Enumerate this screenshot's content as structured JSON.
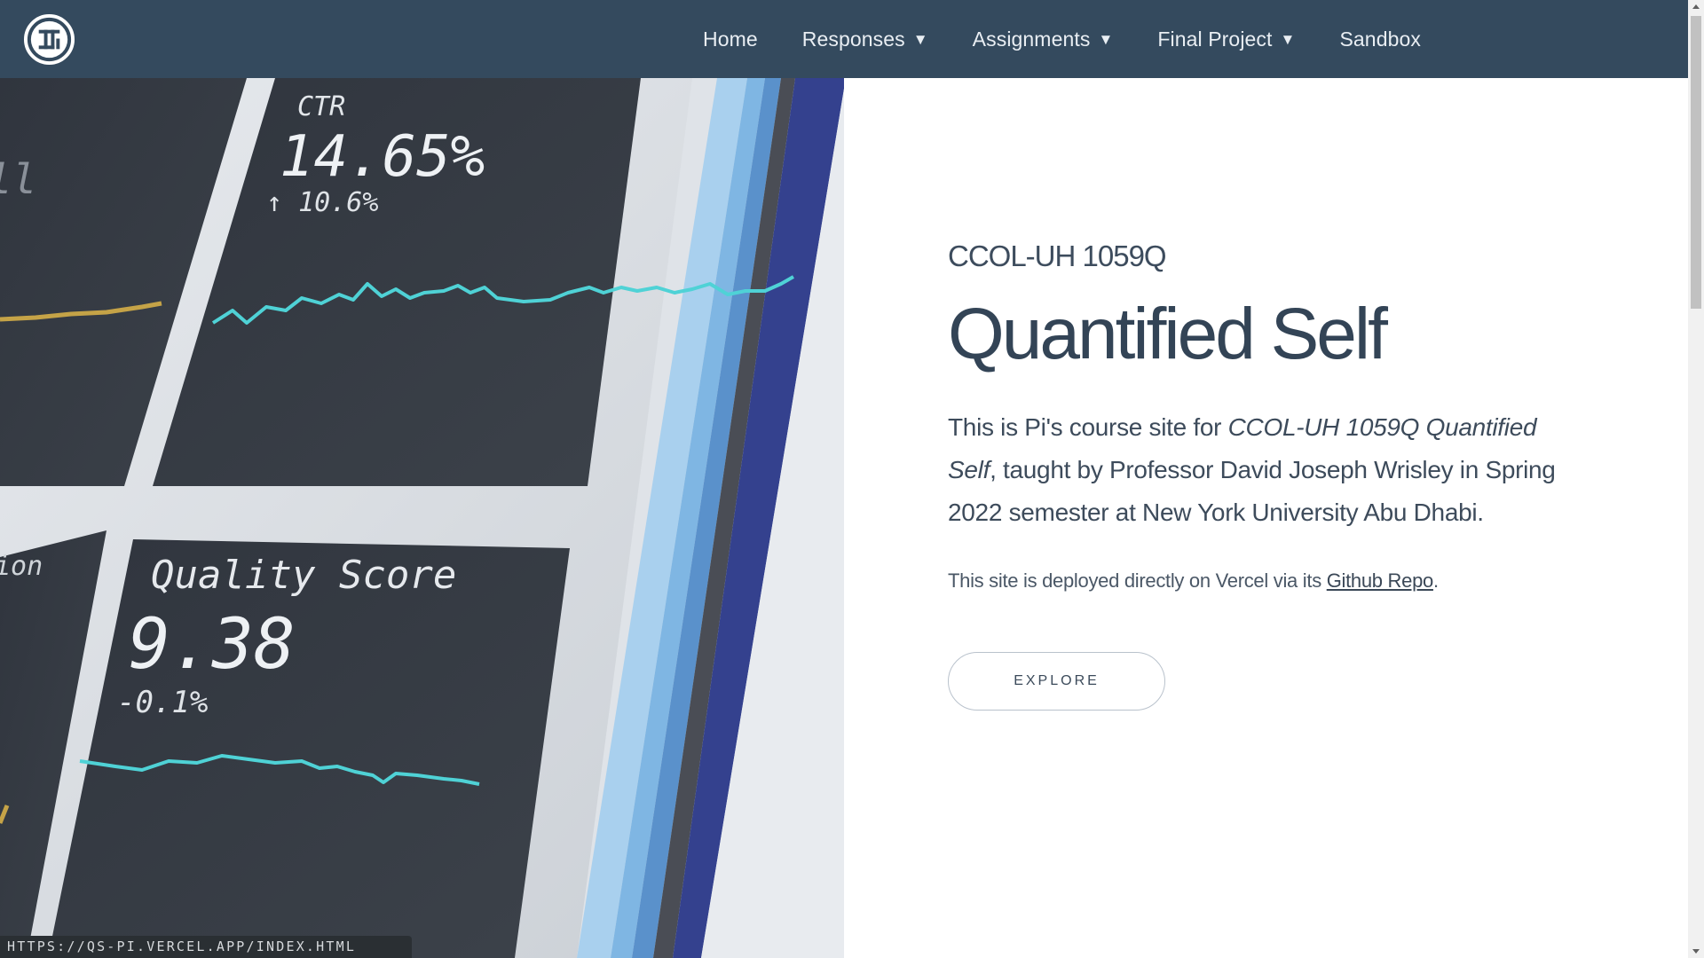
{
  "nav": {
    "items": [
      {
        "label": "Home",
        "has_caret": false
      },
      {
        "label": "Responses",
        "has_caret": true
      },
      {
        "label": "Assignments",
        "has_caret": true
      },
      {
        "label": "Final Project",
        "has_caret": true
      },
      {
        "label": "Sandbox",
        "has_caret": false
      }
    ],
    "caret_glyph": "▼"
  },
  "hero_image": {
    "panels": {
      "ctr_label": "CTR",
      "ctr_value": "14.65%",
      "ctr_change": "↑ 10.6%",
      "quality_label": "Quality Score",
      "quality_value": "9.38",
      "quality_change": "-0.1%",
      "partial_left": "ion",
      "partial_top_left": "ll"
    }
  },
  "main": {
    "course_code": "CCOL-UH 1059Q",
    "title": "Quantified Self",
    "desc_part1": "This is Pi's course site for ",
    "desc_em": "CCOL-UH 1059Q Quantified Self",
    "desc_part2": ", taught by Professor David Joseph Wrisley in Spring 2022 semester at New York University Abu Dhabi.",
    "deploy_text": "This site is deployed directly on Vercel via its ",
    "deploy_link": "Github Repo",
    "deploy_end": ".",
    "explore_label": "EXPLORE"
  },
  "status_bar": {
    "url": "HTTPS://QS-PI.VERCEL.APP/INDEX.HTML"
  },
  "colors": {
    "nav_bg": "#344a5e",
    "text": "#334456",
    "panel_dark": "#2f3640",
    "line_cyan": "#5ed8d8"
  }
}
